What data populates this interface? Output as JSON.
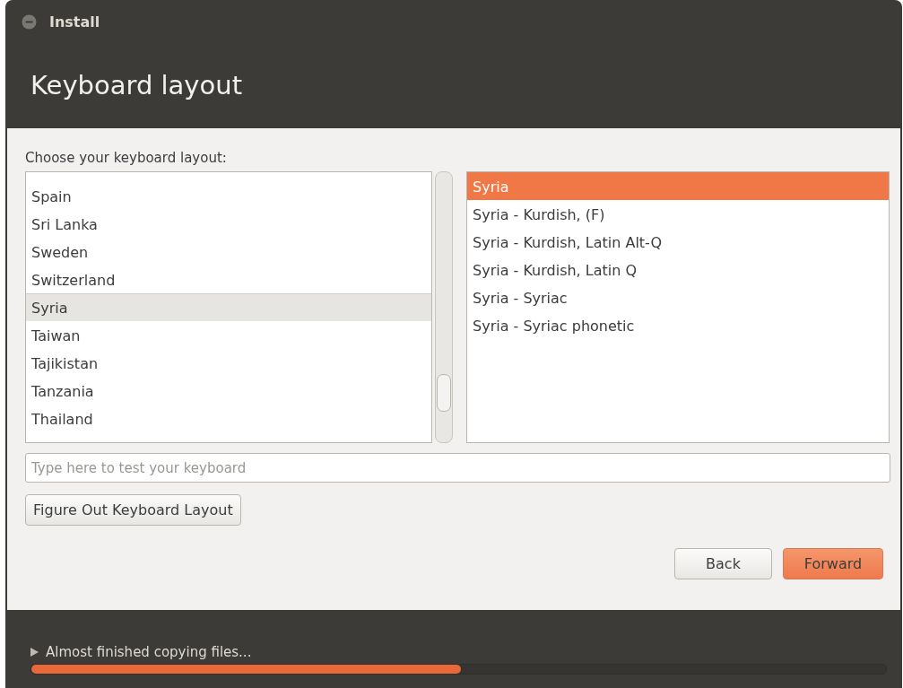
{
  "window": {
    "title": "Install"
  },
  "header": {
    "title": "Keyboard layout"
  },
  "layout_label": "Choose your keyboard layout:",
  "countries": [
    {
      "label": "Spain",
      "selected": false
    },
    {
      "label": "Sri Lanka",
      "selected": false
    },
    {
      "label": "Sweden",
      "selected": false
    },
    {
      "label": "Switzerland",
      "selected": false
    },
    {
      "label": "Syria",
      "selected": true
    },
    {
      "label": "Taiwan",
      "selected": false
    },
    {
      "label": "Tajikistan",
      "selected": false
    },
    {
      "label": "Tanzania",
      "selected": false
    },
    {
      "label": "Thailand",
      "selected": false
    }
  ],
  "variants": [
    {
      "label": "Syria",
      "selected": true
    },
    {
      "label": "Syria - Kurdish, (F)",
      "selected": false
    },
    {
      "label": "Syria - Kurdish, Latin Alt-Q",
      "selected": false
    },
    {
      "label": "Syria - Kurdish, Latin Q",
      "selected": false
    },
    {
      "label": "Syria - Syriac",
      "selected": false
    },
    {
      "label": "Syria - Syriac phonetic",
      "selected": false
    }
  ],
  "test_field": {
    "placeholder": "Type here to test your keyboard"
  },
  "detect_button": "Figure Out Keyboard Layout",
  "buttons": [
    {
      "label": "Back",
      "kind": "secondary"
    },
    {
      "label": "Forward",
      "kind": "primary"
    }
  ],
  "progress": {
    "label": "Almost finished copying files...",
    "level": 0.503
  }
}
